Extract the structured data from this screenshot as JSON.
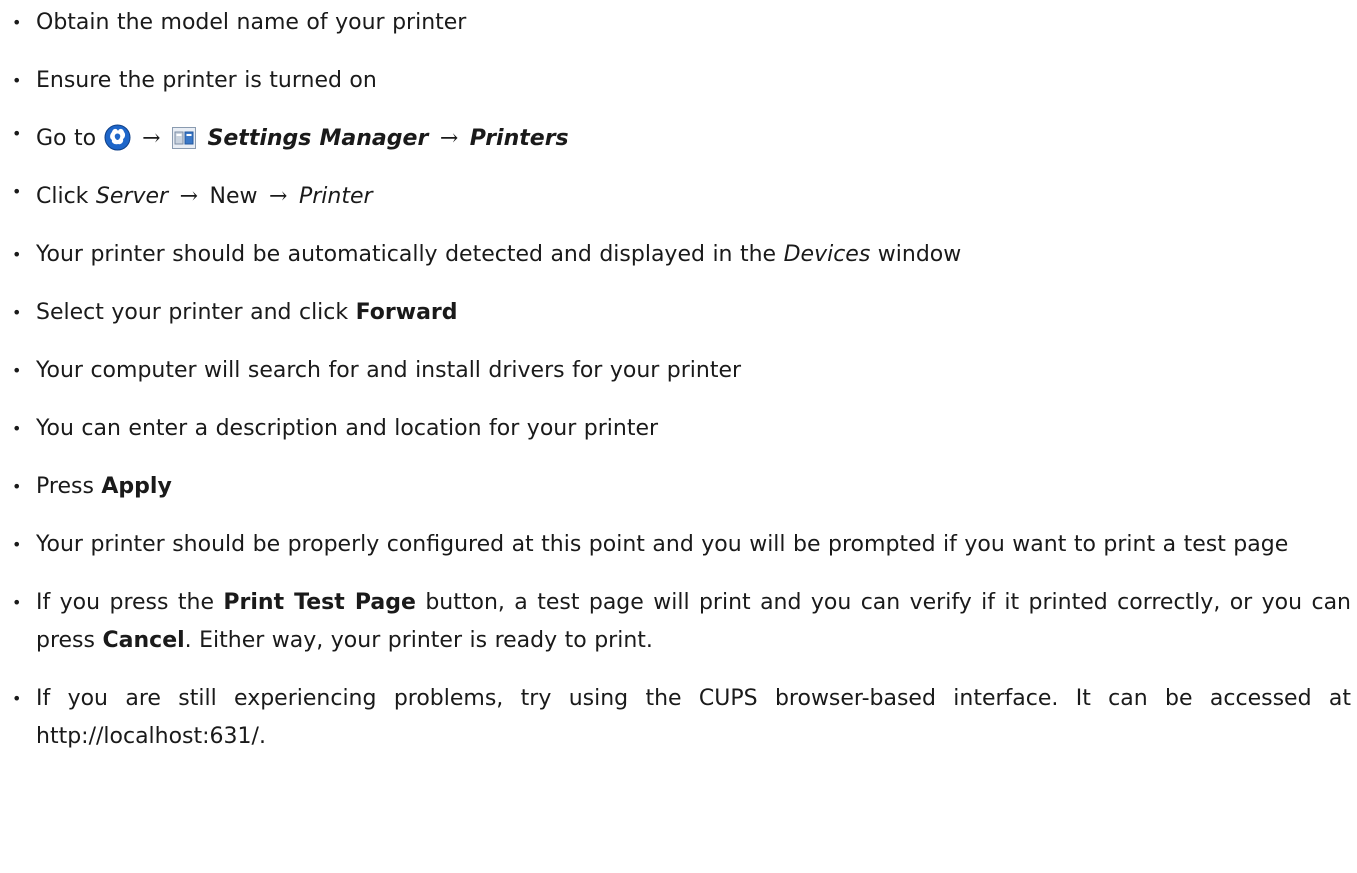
{
  "steps": {
    "s1": {
      "text": "Obtain the model name of your printer"
    },
    "s2": {
      "text": "Ensure the printer is turned on"
    },
    "s3": {
      "prefix": "Go to",
      "arrow1": "→",
      "arrow2": "→",
      "settings_manager": "Settings Manager",
      "printers": "Printers",
      "start_icon": "start-menu-icon",
      "settings_icon": "settings-manager-icon"
    },
    "s4": {
      "prefix": "Click",
      "server": "Server",
      "arrow1": "→",
      "new": "New",
      "arrow2": "→",
      "printer": "Printer"
    },
    "s5": {
      "before": "Your printer should be automatically detected and displayed in the",
      "devices": "Devices",
      "after": "window"
    },
    "s6": {
      "before": "Select your printer and click",
      "forward": "Forward"
    },
    "s7": {
      "text": "Your computer will search for and install drivers for your printer"
    },
    "s8": {
      "text": "You can enter a description and location for your printer"
    },
    "s9": {
      "before": "Press",
      "apply": "Apply"
    },
    "s10": {
      "text": "Your printer should be properly configured at this point and you will be prompted if you want to print a test page"
    },
    "s11": {
      "before": "If you press the",
      "print_test_page": "Print Test Page",
      "middle": "button, a test page will print and you can verify if it printed correctly, or you can press",
      "cancel": "Cancel",
      "after": ". Either way, your printer is ready to print."
    },
    "s12": {
      "text": "If you are still experiencing problems, try using the CUPS browser-based interface. It can be accessed at http://localhost:631/."
    }
  },
  "bullet_char": "•",
  "colors": {
    "text": "#1a1a1a",
    "start_icon_blue": "#1e66c9",
    "settings_icon_blue": "#3a78c8"
  }
}
